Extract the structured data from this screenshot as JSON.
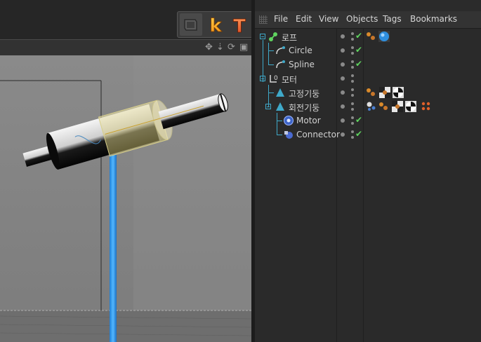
{
  "toolbar": {
    "icons": [
      "layout-icon",
      "k-plugin-icon",
      "t-plugin-icon"
    ],
    "k_label": "k",
    "t_label": "T"
  },
  "viewport": {
    "nav_icons": [
      "move-view-icon",
      "zoom-view-icon",
      "rotate-view-icon",
      "maximize-view-icon"
    ]
  },
  "object_manager": {
    "menu": [
      "File",
      "Edit",
      "View",
      "Objects",
      "Tags",
      "Bookmarks"
    ],
    "objects": [
      {
        "name": "로프",
        "icon": "spline-ik-icon",
        "depth": 0,
        "expandable": true,
        "check": true,
        "tags": [
          "material-tags-icon",
          "sphere-tag-icon"
        ]
      },
      {
        "name": "Circle",
        "icon": "spline-icon",
        "depth": 1,
        "expandable": false,
        "check": true,
        "tags": []
      },
      {
        "name": "Spline",
        "icon": "spline-icon",
        "depth": 1,
        "expandable": false,
        "check": true,
        "tags": []
      },
      {
        "name": "모터",
        "icon": "null-icon",
        "depth": 0,
        "expandable": true,
        "check": false,
        "tags": []
      },
      {
        "name": "고정기둥",
        "icon": "cone-icon",
        "depth": 1,
        "expandable": false,
        "check": false,
        "tags": [
          "material-tags-icon",
          "checker-tag-icon",
          "texture-tag-icon"
        ]
      },
      {
        "name": "회전기둥",
        "icon": "cone-icon",
        "depth": 1,
        "expandable": true,
        "check": false,
        "tags": [
          "dynamics-tag-icon",
          "material-tags-icon",
          "checker-tag-icon",
          "texture-tag-icon",
          "points-tag-icon"
        ]
      },
      {
        "name": "Motor",
        "icon": "motor-icon",
        "depth": 2,
        "expandable": false,
        "check": true,
        "tags": []
      },
      {
        "name": "Connector",
        "icon": "connector-icon",
        "depth": 2,
        "expandable": false,
        "check": true,
        "tags": []
      }
    ],
    "check_mark": "✔",
    "colors": {
      "tree": "#3fa9c9",
      "check": "#5fd35f"
    }
  }
}
